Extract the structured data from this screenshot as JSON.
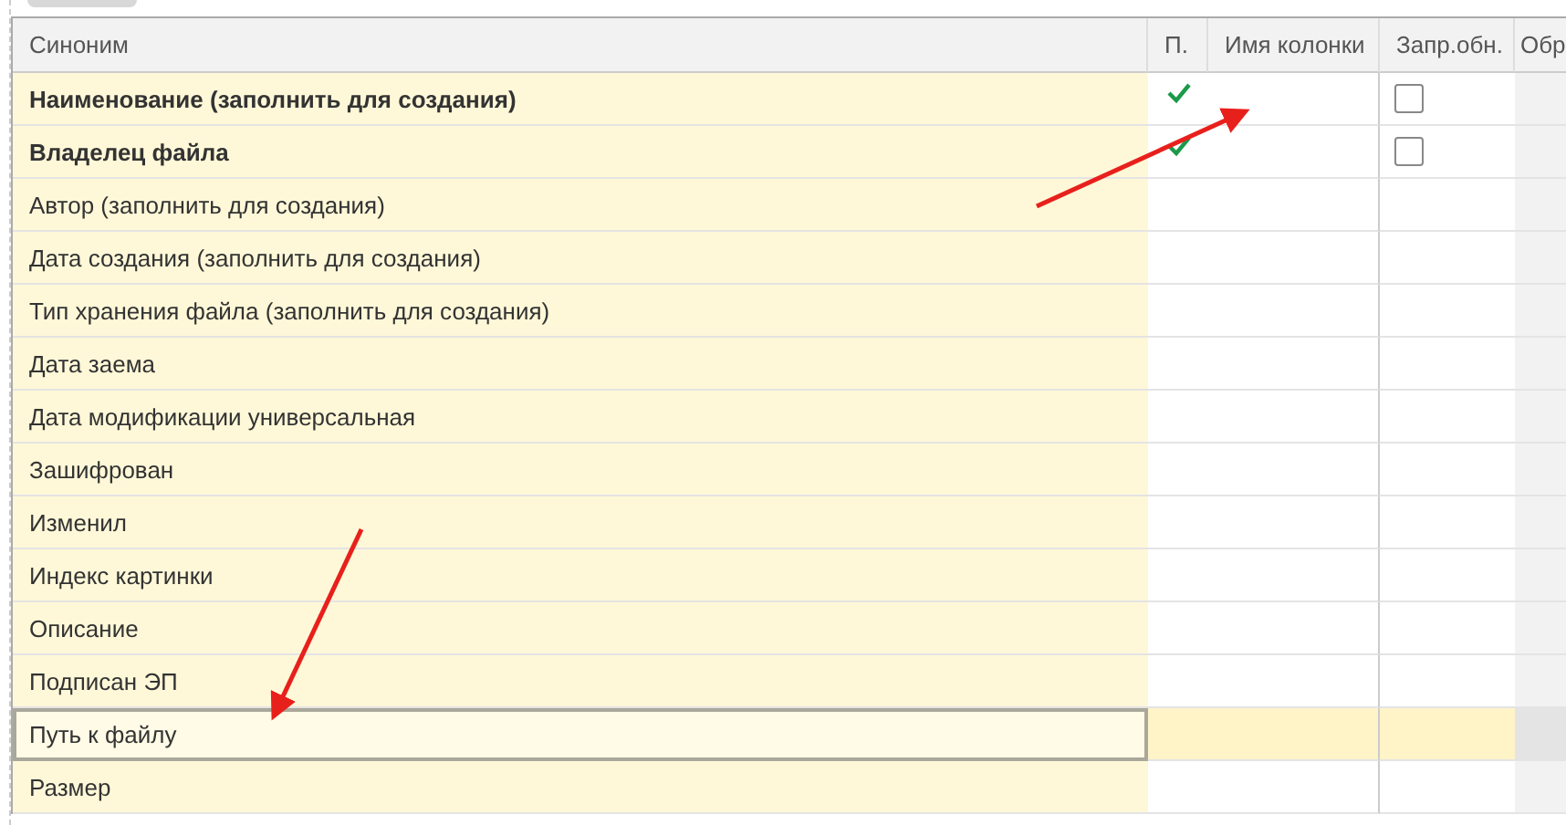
{
  "columns": [
    "Синоним",
    "П.",
    "Имя колонки",
    "Запр.обн.",
    "Обр"
  ],
  "rows": [
    {
      "synonym": "Наименование (заполнить для создания)",
      "bold": true,
      "p": true,
      "refresh": false,
      "selected": false
    },
    {
      "synonym": "Владелец файла",
      "bold": true,
      "p": true,
      "refresh": false,
      "selected": false
    },
    {
      "synonym": "Автор (заполнить для создания)",
      "bold": false,
      "p": false,
      "selected": false
    },
    {
      "synonym": "Дата создания (заполнить для создания)",
      "bold": false,
      "p": false,
      "selected": false
    },
    {
      "synonym": "Тип хранения файла (заполнить для создания)",
      "bold": false,
      "p": false,
      "selected": false
    },
    {
      "synonym": "Дата заема",
      "bold": false,
      "p": false,
      "selected": false
    },
    {
      "synonym": "Дата модификации универсальная",
      "bold": false,
      "p": false,
      "selected": false
    },
    {
      "synonym": "Зашифрован",
      "bold": false,
      "p": false,
      "selected": false
    },
    {
      "synonym": "Изменил",
      "bold": false,
      "p": false,
      "selected": false
    },
    {
      "synonym": "Индекс картинки",
      "bold": false,
      "p": false,
      "selected": false
    },
    {
      "synonym": "Описание",
      "bold": false,
      "p": false,
      "selected": false
    },
    {
      "synonym": "Подписан ЭП",
      "bold": false,
      "p": false,
      "selected": false
    },
    {
      "synonym": "Путь к файлу",
      "bold": false,
      "p": false,
      "selected": true
    },
    {
      "synonym": "Размер",
      "bold": false,
      "p": false,
      "selected": false
    }
  ]
}
